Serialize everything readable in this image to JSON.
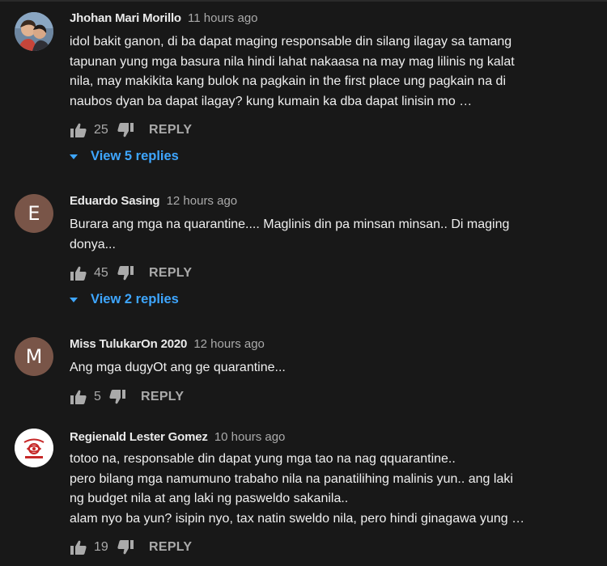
{
  "colors": {
    "background": "#181818",
    "link_blue": "#3ea6ff",
    "secondary_text": "#aaaaaa",
    "avatar_brown": "#795548",
    "avatar_white": "#ffffff"
  },
  "comments": [
    {
      "author": "Jhohan Mari Morillo",
      "time": "11 hours ago",
      "avatar": "photo",
      "lines": [
        "idol bakit ganon, di ba dapat maging responsable din silang ilagay sa tamang",
        "tapunan yung mga basura nila hindi lahat nakaasa na may mag lilinis ng kalat",
        "nila, may makikita kang bulok na pagkain in the first place ung pagkain na di",
        "naubos dyan ba dapat ilagay? kung kumain ka dba dapat linisin mo …"
      ],
      "likes": "25",
      "reply_label": "REPLY",
      "view_replies": "View 5 replies"
    },
    {
      "author": "Eduardo Sasing",
      "time": "12 hours ago",
      "avatar": "E",
      "lines": [
        "Burara ang mga na quarantine.... Maglinis  din  pa minsan minsan.. Di maging",
        "donya..."
      ],
      "likes": "45",
      "reply_label": "REPLY",
      "view_replies": "View 2 replies"
    },
    {
      "author": "Miss TulukarOn 2020",
      "time": "12 hours ago",
      "avatar": "M",
      "lines": [
        "Ang mga dugyOt ang ge quarantine..."
      ],
      "likes": "5",
      "reply_label": "REPLY"
    },
    {
      "author": "Regienald Lester Gomez",
      "time": "10 hours ago",
      "avatar": "logo",
      "lines": [
        "totoo na, responsable din dapat yung mga tao na nag qquarantine..",
        "pero bilang mga namumuno trabaho nila na panatilihing malinis yun.. ang laki",
        "ng budget nila at ang laki ng pasweldo sakanila..",
        "alam nyo ba yun? isipin nyo, tax natin sweldo nila, pero hindi ginagawa yung …"
      ],
      "likes": "19",
      "reply_label": "REPLY"
    }
  ]
}
